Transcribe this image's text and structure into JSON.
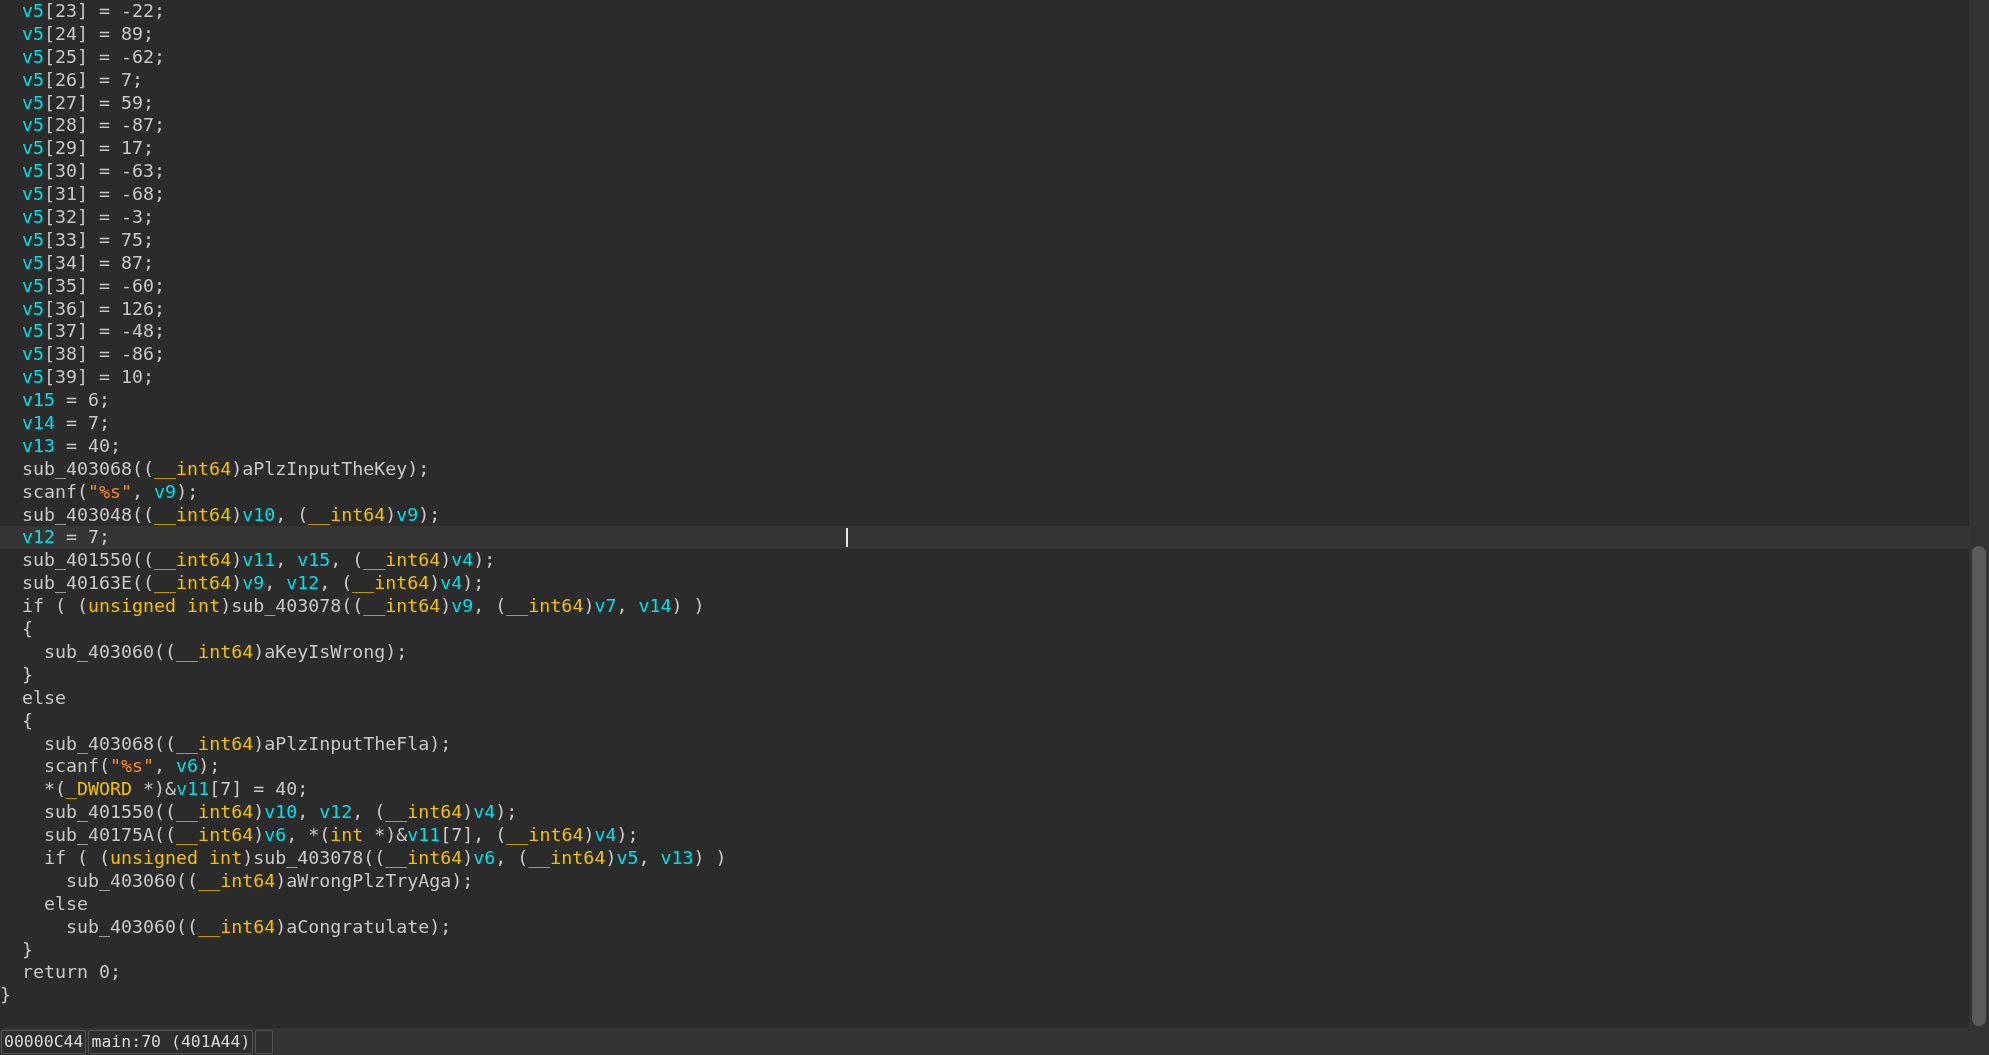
{
  "lines": [
    {
      "highlighted": false,
      "tokens": [
        {
          "kind": "var",
          "text": "  v5"
        },
        {
          "kind": "plain",
          "text": "[23] = -22;"
        }
      ]
    },
    {
      "highlighted": false,
      "tokens": [
        {
          "kind": "var",
          "text": "  v5"
        },
        {
          "kind": "plain",
          "text": "[24] = 89;"
        }
      ]
    },
    {
      "highlighted": false,
      "tokens": [
        {
          "kind": "var",
          "text": "  v5"
        },
        {
          "kind": "plain",
          "text": "[25] = -62;"
        }
      ]
    },
    {
      "highlighted": false,
      "tokens": [
        {
          "kind": "var",
          "text": "  v5"
        },
        {
          "kind": "plain",
          "text": "[26] = 7;"
        }
      ]
    },
    {
      "highlighted": false,
      "tokens": [
        {
          "kind": "var",
          "text": "  v5"
        },
        {
          "kind": "plain",
          "text": "[27] = 59;"
        }
      ]
    },
    {
      "highlighted": false,
      "tokens": [
        {
          "kind": "var",
          "text": "  v5"
        },
        {
          "kind": "plain",
          "text": "[28] = -87;"
        }
      ]
    },
    {
      "highlighted": false,
      "tokens": [
        {
          "kind": "var",
          "text": "  v5"
        },
        {
          "kind": "plain",
          "text": "[29] = 17;"
        }
      ]
    },
    {
      "highlighted": false,
      "tokens": [
        {
          "kind": "var",
          "text": "  v5"
        },
        {
          "kind": "plain",
          "text": "[30] = -63;"
        }
      ]
    },
    {
      "highlighted": false,
      "tokens": [
        {
          "kind": "var",
          "text": "  v5"
        },
        {
          "kind": "plain",
          "text": "[31] = -68;"
        }
      ]
    },
    {
      "highlighted": false,
      "tokens": [
        {
          "kind": "var",
          "text": "  v5"
        },
        {
          "kind": "plain",
          "text": "[32] = -3;"
        }
      ]
    },
    {
      "highlighted": false,
      "tokens": [
        {
          "kind": "var",
          "text": "  v5"
        },
        {
          "kind": "plain",
          "text": "[33] = 75;"
        }
      ]
    },
    {
      "highlighted": false,
      "tokens": [
        {
          "kind": "var",
          "text": "  v5"
        },
        {
          "kind": "plain",
          "text": "[34] = 87;"
        }
      ]
    },
    {
      "highlighted": false,
      "tokens": [
        {
          "kind": "var",
          "text": "  v5"
        },
        {
          "kind": "plain",
          "text": "[35] = -60;"
        }
      ]
    },
    {
      "highlighted": false,
      "tokens": [
        {
          "kind": "var",
          "text": "  v5"
        },
        {
          "kind": "plain",
          "text": "[36] = 126;"
        }
      ]
    },
    {
      "highlighted": false,
      "tokens": [
        {
          "kind": "var",
          "text": "  v5"
        },
        {
          "kind": "plain",
          "text": "[37] = -48;"
        }
      ]
    },
    {
      "highlighted": false,
      "tokens": [
        {
          "kind": "var",
          "text": "  v5"
        },
        {
          "kind": "plain",
          "text": "[38] = -86;"
        }
      ]
    },
    {
      "highlighted": false,
      "tokens": [
        {
          "kind": "var",
          "text": "  v5"
        },
        {
          "kind": "plain",
          "text": "[39] = 10;"
        }
      ]
    },
    {
      "highlighted": false,
      "tokens": [
        {
          "kind": "var",
          "text": "  v15"
        },
        {
          "kind": "plain",
          "text": " = 6;"
        }
      ]
    },
    {
      "highlighted": false,
      "tokens": [
        {
          "kind": "var",
          "text": "  v14"
        },
        {
          "kind": "plain",
          "text": " = 7;"
        }
      ]
    },
    {
      "highlighted": false,
      "tokens": [
        {
          "kind": "var",
          "text": "  v13"
        },
        {
          "kind": "plain",
          "text": " = 40;"
        }
      ]
    },
    {
      "highlighted": false,
      "tokens": [
        {
          "kind": "plain",
          "text": "  sub_403068(("
        },
        {
          "kind": "type",
          "text": "__int64"
        },
        {
          "kind": "plain",
          "text": ")aPlzInputTheKey);"
        }
      ]
    },
    {
      "highlighted": false,
      "tokens": [
        {
          "kind": "plain",
          "text": "  scanf("
        },
        {
          "kind": "string",
          "text": "\"%s\""
        },
        {
          "kind": "plain",
          "text": ", "
        },
        {
          "kind": "var",
          "text": "v9"
        },
        {
          "kind": "plain",
          "text": ");"
        }
      ]
    },
    {
      "highlighted": false,
      "tokens": [
        {
          "kind": "plain",
          "text": "  sub_403048(("
        },
        {
          "kind": "type",
          "text": "__int64"
        },
        {
          "kind": "plain",
          "text": ")"
        },
        {
          "kind": "var",
          "text": "v10"
        },
        {
          "kind": "plain",
          "text": ", ("
        },
        {
          "kind": "type",
          "text": "__int64"
        },
        {
          "kind": "plain",
          "text": ")"
        },
        {
          "kind": "var",
          "text": "v9"
        },
        {
          "kind": "plain",
          "text": ");"
        }
      ]
    },
    {
      "highlighted": true,
      "tokens": [
        {
          "kind": "var",
          "text": "  v12"
        },
        {
          "kind": "plain",
          "text": " = 7;"
        }
      ]
    },
    {
      "highlighted": false,
      "tokens": [
        {
          "kind": "plain",
          "text": "  sub_401550(("
        },
        {
          "kind": "type",
          "text": "__int64"
        },
        {
          "kind": "plain",
          "text": ")"
        },
        {
          "kind": "var",
          "text": "v11"
        },
        {
          "kind": "plain",
          "text": ", "
        },
        {
          "kind": "var",
          "text": "v15"
        },
        {
          "kind": "plain",
          "text": ", ("
        },
        {
          "kind": "type",
          "text": "__int64"
        },
        {
          "kind": "plain",
          "text": ")"
        },
        {
          "kind": "var",
          "text": "v4"
        },
        {
          "kind": "plain",
          "text": ");"
        }
      ]
    },
    {
      "highlighted": false,
      "tokens": [
        {
          "kind": "plain",
          "text": "  sub_40163E(("
        },
        {
          "kind": "type",
          "text": "__int64"
        },
        {
          "kind": "plain",
          "text": ")"
        },
        {
          "kind": "var",
          "text": "v9"
        },
        {
          "kind": "plain",
          "text": ", "
        },
        {
          "kind": "var",
          "text": "v12"
        },
        {
          "kind": "plain",
          "text": ", ("
        },
        {
          "kind": "type",
          "text": "__int64"
        },
        {
          "kind": "plain",
          "text": ")"
        },
        {
          "kind": "var",
          "text": "v4"
        },
        {
          "kind": "plain",
          "text": ");"
        }
      ]
    },
    {
      "highlighted": false,
      "tokens": [
        {
          "kind": "plain",
          "text": "  if ( ("
        },
        {
          "kind": "type",
          "text": "unsigned int"
        },
        {
          "kind": "plain",
          "text": ")sub_403078(("
        },
        {
          "kind": "type",
          "text": "__int64"
        },
        {
          "kind": "plain",
          "text": ")"
        },
        {
          "kind": "var",
          "text": "v9"
        },
        {
          "kind": "plain",
          "text": ", ("
        },
        {
          "kind": "type",
          "text": "__int64"
        },
        {
          "kind": "plain",
          "text": ")"
        },
        {
          "kind": "var",
          "text": "v7"
        },
        {
          "kind": "plain",
          "text": ", "
        },
        {
          "kind": "var",
          "text": "v14"
        },
        {
          "kind": "plain",
          "text": ") )"
        }
      ]
    },
    {
      "highlighted": false,
      "tokens": [
        {
          "kind": "plain",
          "text": "  {"
        }
      ]
    },
    {
      "highlighted": false,
      "tokens": [
        {
          "kind": "plain",
          "text": "    sub_403060(("
        },
        {
          "kind": "type",
          "text": "__int64"
        },
        {
          "kind": "plain",
          "text": ")aKeyIsWrong);"
        }
      ]
    },
    {
      "highlighted": false,
      "tokens": [
        {
          "kind": "plain",
          "text": "  }"
        }
      ]
    },
    {
      "highlighted": false,
      "tokens": [
        {
          "kind": "plain",
          "text": "  else"
        }
      ]
    },
    {
      "highlighted": false,
      "tokens": [
        {
          "kind": "plain",
          "text": "  {"
        }
      ]
    },
    {
      "highlighted": false,
      "tokens": [
        {
          "kind": "plain",
          "text": "    sub_403068(("
        },
        {
          "kind": "type",
          "text": "__int64"
        },
        {
          "kind": "plain",
          "text": ")aPlzInputTheFla);"
        }
      ]
    },
    {
      "highlighted": false,
      "tokens": [
        {
          "kind": "plain",
          "text": "    scanf("
        },
        {
          "kind": "string",
          "text": "\"%s\""
        },
        {
          "kind": "plain",
          "text": ", "
        },
        {
          "kind": "var",
          "text": "v6"
        },
        {
          "kind": "plain",
          "text": ");"
        }
      ]
    },
    {
      "highlighted": false,
      "tokens": [
        {
          "kind": "plain",
          "text": "    *("
        },
        {
          "kind": "type",
          "text": "_DWORD"
        },
        {
          "kind": "plain",
          "text": " *)&"
        },
        {
          "kind": "var",
          "text": "v11"
        },
        {
          "kind": "plain",
          "text": "[7] = 40;"
        }
      ]
    },
    {
      "highlighted": false,
      "tokens": [
        {
          "kind": "plain",
          "text": "    sub_401550(("
        },
        {
          "kind": "type",
          "text": "__int64"
        },
        {
          "kind": "plain",
          "text": ")"
        },
        {
          "kind": "var",
          "text": "v10"
        },
        {
          "kind": "plain",
          "text": ", "
        },
        {
          "kind": "var",
          "text": "v12"
        },
        {
          "kind": "plain",
          "text": ", ("
        },
        {
          "kind": "type",
          "text": "__int64"
        },
        {
          "kind": "plain",
          "text": ")"
        },
        {
          "kind": "var",
          "text": "v4"
        },
        {
          "kind": "plain",
          "text": ");"
        }
      ]
    },
    {
      "highlighted": false,
      "tokens": [
        {
          "kind": "plain",
          "text": "    sub_40175A(("
        },
        {
          "kind": "type",
          "text": "__int64"
        },
        {
          "kind": "plain",
          "text": ")"
        },
        {
          "kind": "var",
          "text": "v6"
        },
        {
          "kind": "plain",
          "text": ", *("
        },
        {
          "kind": "type",
          "text": "int"
        },
        {
          "kind": "plain",
          "text": " *)&"
        },
        {
          "kind": "var",
          "text": "v11"
        },
        {
          "kind": "plain",
          "text": "[7], ("
        },
        {
          "kind": "type",
          "text": "__int64"
        },
        {
          "kind": "plain",
          "text": ")"
        },
        {
          "kind": "var",
          "text": "v4"
        },
        {
          "kind": "plain",
          "text": ");"
        }
      ]
    },
    {
      "highlighted": false,
      "tokens": [
        {
          "kind": "plain",
          "text": "    if ( ("
        },
        {
          "kind": "type",
          "text": "unsigned int"
        },
        {
          "kind": "plain",
          "text": ")sub_403078(("
        },
        {
          "kind": "type",
          "text": "__int64"
        },
        {
          "kind": "plain",
          "text": ")"
        },
        {
          "kind": "var",
          "text": "v6"
        },
        {
          "kind": "plain",
          "text": ", ("
        },
        {
          "kind": "type",
          "text": "__int64"
        },
        {
          "kind": "plain",
          "text": ")"
        },
        {
          "kind": "var",
          "text": "v5"
        },
        {
          "kind": "plain",
          "text": ", "
        },
        {
          "kind": "var",
          "text": "v13"
        },
        {
          "kind": "plain",
          "text": ") )"
        }
      ]
    },
    {
      "highlighted": false,
      "tokens": [
        {
          "kind": "plain",
          "text": "      sub_403060(("
        },
        {
          "kind": "type",
          "text": "__int64"
        },
        {
          "kind": "plain",
          "text": ")aWrongPlzTryAga);"
        }
      ]
    },
    {
      "highlighted": false,
      "tokens": [
        {
          "kind": "plain",
          "text": "    else"
        }
      ]
    },
    {
      "highlighted": false,
      "tokens": [
        {
          "kind": "plain",
          "text": "      sub_403060(("
        },
        {
          "kind": "type",
          "text": "__int64"
        },
        {
          "kind": "plain",
          "text": ")aCongratulate);"
        }
      ]
    },
    {
      "highlighted": false,
      "tokens": [
        {
          "kind": "plain",
          "text": "  }"
        }
      ]
    },
    {
      "highlighted": false,
      "tokens": [
        {
          "kind": "plain",
          "text": "  return 0;"
        }
      ]
    },
    {
      "highlighted": false,
      "tokens": [
        {
          "kind": "plain",
          "text": "}"
        }
      ]
    }
  ],
  "status_bar": {
    "offset": "00000C44",
    "location": "main:70 (401A44)"
  }
}
